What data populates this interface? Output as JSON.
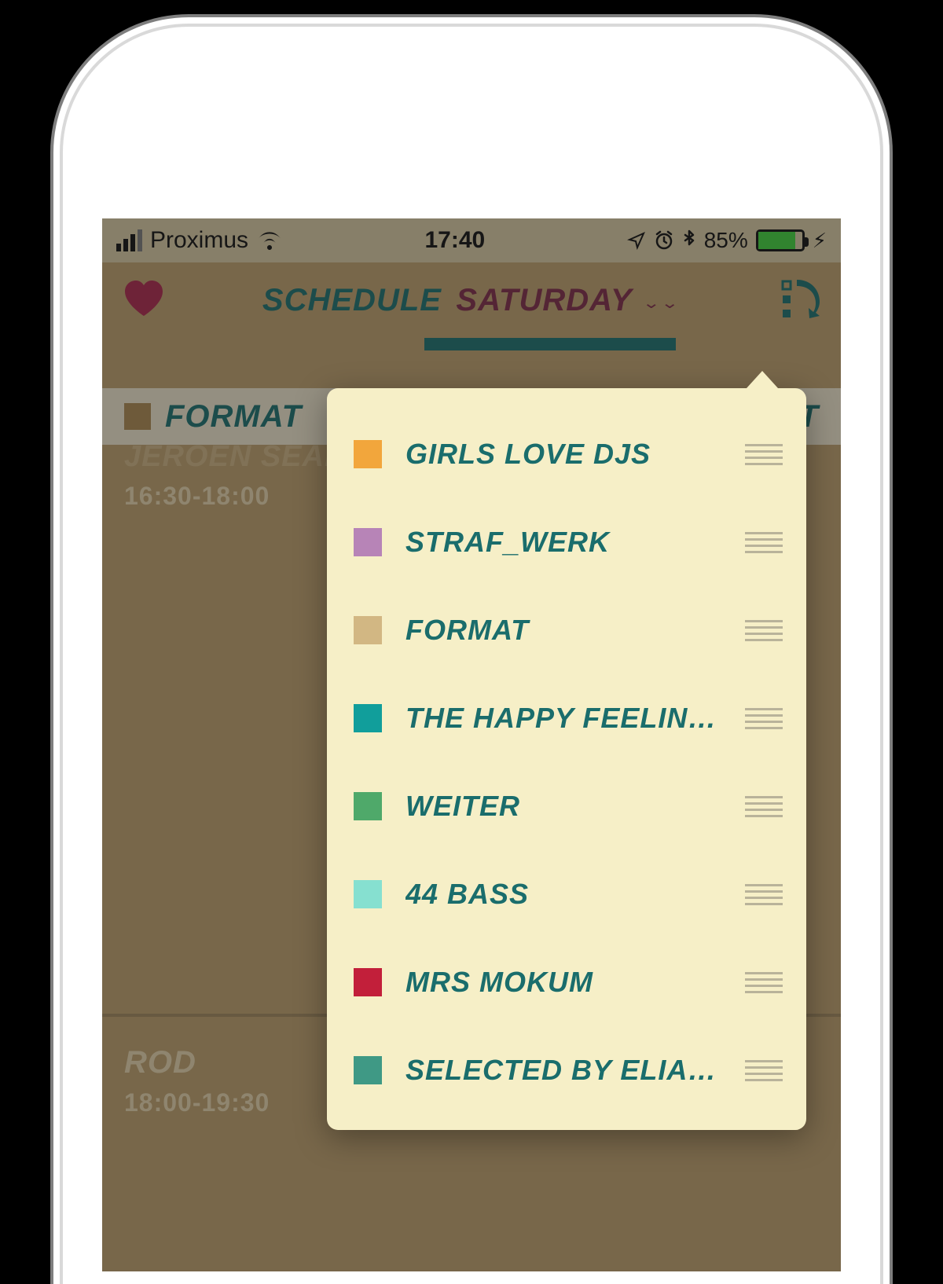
{
  "statusbar": {
    "carrier": "Proximus",
    "time": "17:40",
    "battery_pct": "85%"
  },
  "header": {
    "title_left": "SCHEDULE",
    "title_right": "SATURDAY"
  },
  "columns": {
    "left_label": "FORMAT",
    "right_peek": "EIT"
  },
  "schedule": {
    "slot1_artist": "JEROEN SEARCH",
    "slot1_time": "16:30-18:00",
    "slot2_artist": "ROD",
    "slot2_time": "18:00-19:30"
  },
  "popover": {
    "items": [
      {
        "label": "GIRLS LOVE DJS",
        "color": "#f2a63c"
      },
      {
        "label": "STRAF_WERK",
        "color": "#b784b7"
      },
      {
        "label": "FORMAT",
        "color": "#d2b783"
      },
      {
        "label": "THE HAPPY FEELINGS",
        "color": "#119e9b"
      },
      {
        "label": "WEITER",
        "color": "#4fa96a"
      },
      {
        "label": "44 BASS",
        "color": "#86e0d0"
      },
      {
        "label": "MRS MOKUM",
        "color": "#c21f3a"
      },
      {
        "label": "SELECTED BY ELIAS MAZ...",
        "color": "#3f9985"
      }
    ]
  }
}
